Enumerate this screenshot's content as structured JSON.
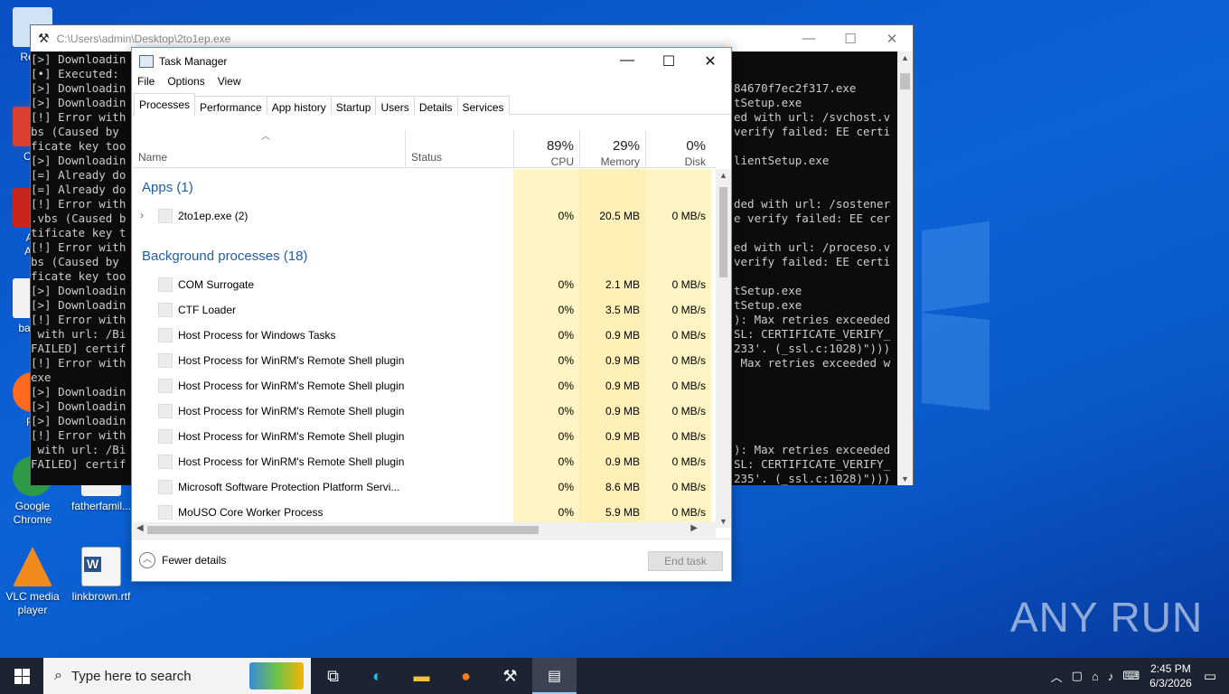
{
  "desktop": {
    "icons": [
      {
        "label": "Recy",
        "kind": "recycle"
      },
      {
        "label": "CCl",
        "kind": "ccleaner"
      },
      {
        "label": "Ad\nAcr",
        "kind": "acrobat"
      },
      {
        "label": "basist",
        "kind": "doc"
      },
      {
        "label": "Fir",
        "kind": "firefox"
      },
      {
        "label": "Google\nChrome",
        "kind": "chrome"
      },
      {
        "label": "fatherfamil...",
        "kind": "doc"
      },
      {
        "label": "VLC media\nplayer",
        "kind": "vlc"
      },
      {
        "label": "linkbrown.rtf",
        "kind": "word"
      }
    ]
  },
  "console": {
    "title": "C:\\Users\\admin\\Desktop\\2to1ep.exe",
    "left_lines": "[>] Downloadin\n[•] Executed: \n[>] Downloadin\n[>] Downloadin\n[!] Error with\nbs (Caused by \nficate key too\n[>] Downloadin\n[=] Already do\n[=] Already do\n[!] Error with\n.vbs (Caused b\ntificate key t\n[!] Error with\nbs (Caused by \nficate key too\n[>] Downloadin\n[>] Downloadin\n[!] Error with\n with url: /Bi\nFAILED] certif\n[!] Error with\nexe\n[>] Downloadin\n[>] Downloadin\n[>] Downloadin\n[!] Error with\n with url: /Bi\nFAILED] certif",
    "right_lines": "84670f7ec2f317.exe\ntSetup.exe\ned with url: /svchost.v\nverify failed: EE certi\n\nlientSetup.exe\n\n\nded with url: /sostener\ne verify failed: EE cer\n\ned with url: /proceso.v\nverify failed: EE certi\n\ntSetup.exe\ntSetup.exe\n): Max retries exceeded\nSL: CERTIFICATE_VERIFY_\n233'. (_ssl.c:1028)\")))\n Max retries exceeded w\n\n\n\n\n\n): Max retries exceeded\nSL: CERTIFICATE_VERIFY_\n235'. (_ssl.c:1028)\")))"
  },
  "taskmanager": {
    "title": "Task Manager",
    "menu": [
      "File",
      "Options",
      "View"
    ],
    "tabs": [
      "Processes",
      "Performance",
      "App history",
      "Startup",
      "Users",
      "Details",
      "Services"
    ],
    "active_tab": "Processes",
    "header": {
      "name": "Name",
      "status": "Status",
      "cpu_pct": "89%",
      "cpu_label": "CPU",
      "mem_pct": "29%",
      "mem_label": "Memory",
      "disk_pct": "0%",
      "disk_label": "Disk"
    },
    "groups": {
      "apps": "Apps (1)",
      "background": "Background processes (18)"
    },
    "apps": [
      {
        "name": "2to1ep.exe (2)",
        "cpu": "0%",
        "mem": "20.5 MB",
        "disk": "0 MB/s"
      }
    ],
    "background": [
      {
        "name": "COM Surrogate",
        "cpu": "0%",
        "mem": "2.1 MB",
        "disk": "0 MB/s"
      },
      {
        "name": "CTF Loader",
        "cpu": "0%",
        "mem": "3.5 MB",
        "disk": "0 MB/s"
      },
      {
        "name": "Host Process for Windows Tasks",
        "cpu": "0%",
        "mem": "0.9 MB",
        "disk": "0 MB/s"
      },
      {
        "name": "Host Process for WinRM's Remote Shell plugin",
        "cpu": "0%",
        "mem": "0.9 MB",
        "disk": "0 MB/s"
      },
      {
        "name": "Host Process for WinRM's Remote Shell plugin",
        "cpu": "0%",
        "mem": "0.9 MB",
        "disk": "0 MB/s"
      },
      {
        "name": "Host Process for WinRM's Remote Shell plugin",
        "cpu": "0%",
        "mem": "0.9 MB",
        "disk": "0 MB/s"
      },
      {
        "name": "Host Process for WinRM's Remote Shell plugin",
        "cpu": "0%",
        "mem": "0.9 MB",
        "disk": "0 MB/s"
      },
      {
        "name": "Host Process for WinRM's Remote Shell plugin",
        "cpu": "0%",
        "mem": "0.9 MB",
        "disk": "0 MB/s"
      },
      {
        "name": "Microsoft Software Protection Platform Servi...",
        "cpu": "0%",
        "mem": "8.6 MB",
        "disk": "0 MB/s"
      },
      {
        "name": "MoUSO Core Worker Process",
        "cpu": "0%",
        "mem": "5.9 MB",
        "disk": "0 MB/s"
      }
    ],
    "footer": {
      "fewer_details": "Fewer details",
      "end_task": "End task"
    }
  },
  "taskbar": {
    "search_placeholder": "Type here to search",
    "time": "2:45 PM",
    "date": "6/3/2026"
  },
  "watermark": "ANY RUN"
}
